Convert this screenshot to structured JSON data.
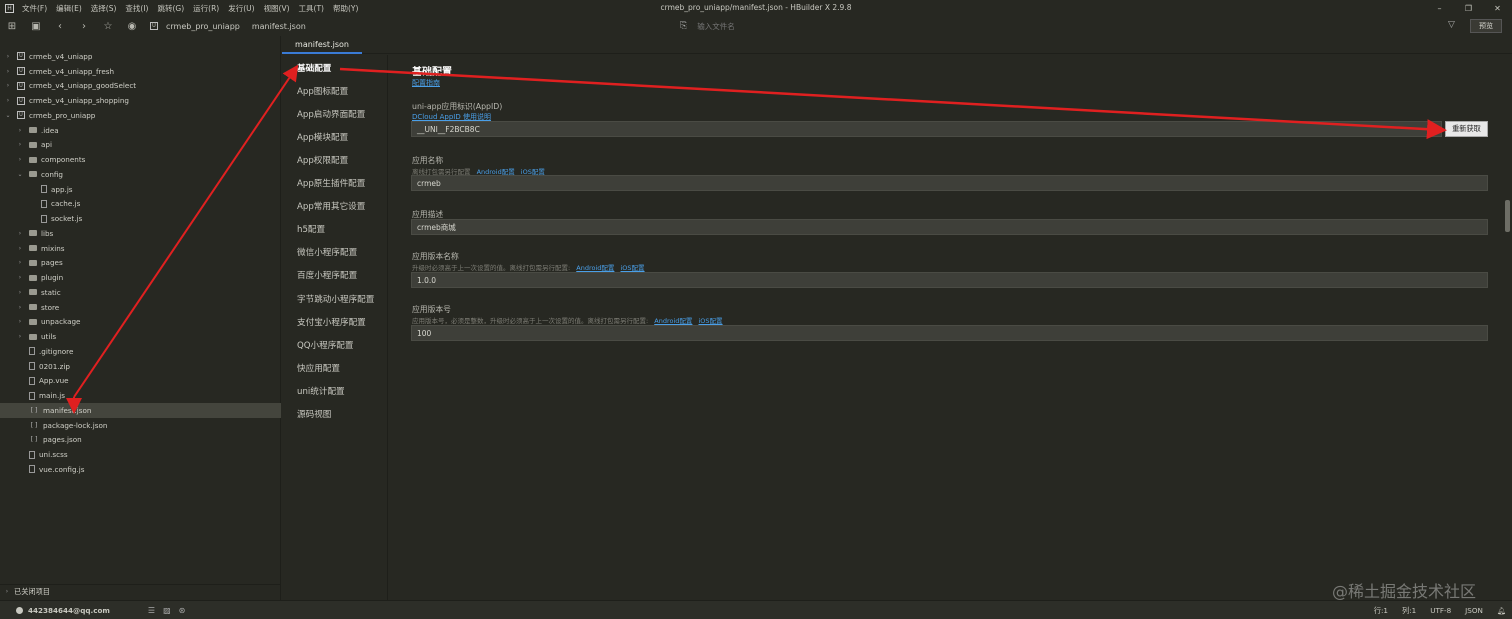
{
  "window": {
    "title": "crmeb_pro_uniapp/manifest.json - HBuilder X 2.9.8"
  },
  "menu": [
    "文件(F)",
    "编辑(E)",
    "选择(S)",
    "查找(I)",
    "跳转(G)",
    "运行(R)",
    "发行(U)",
    "视图(V)",
    "工具(T)",
    "帮助(Y)"
  ],
  "toolbar": {
    "crumb_project": "crmeb_pro_uniapp",
    "crumb_file": "manifest.json",
    "file_search_placeholder": "输入文件名",
    "preview_label": "预览"
  },
  "tree": [
    {
      "label": "crmeb_v4_uniapp",
      "kind": "proj",
      "depth": 0,
      "tw": "›"
    },
    {
      "label": "crmeb_v4_uniapp_fresh",
      "kind": "proj",
      "depth": 0,
      "tw": "›"
    },
    {
      "label": "crmeb_v4_uniapp_goodSelect",
      "kind": "proj",
      "depth": 0,
      "tw": "›"
    },
    {
      "label": "crmeb_v4_uniapp_shopping",
      "kind": "proj",
      "depth": 0,
      "tw": "›"
    },
    {
      "label": "crmeb_pro_uniapp",
      "kind": "proj",
      "depth": 0,
      "tw": "⌄"
    },
    {
      "label": ".idea",
      "kind": "folder",
      "depth": 1,
      "tw": "›"
    },
    {
      "label": "api",
      "kind": "folder",
      "depth": 1,
      "tw": "›"
    },
    {
      "label": "components",
      "kind": "folder",
      "depth": 1,
      "tw": "›"
    },
    {
      "label": "config",
      "kind": "folder",
      "depth": 1,
      "tw": "⌄"
    },
    {
      "label": "app.js",
      "kind": "file",
      "depth": 2,
      "tw": ""
    },
    {
      "label": "cache.js",
      "kind": "file",
      "depth": 2,
      "tw": ""
    },
    {
      "label": "socket.js",
      "kind": "file",
      "depth": 2,
      "tw": ""
    },
    {
      "label": "libs",
      "kind": "folder",
      "depth": 1,
      "tw": "›"
    },
    {
      "label": "mixins",
      "kind": "folder",
      "depth": 1,
      "tw": "›"
    },
    {
      "label": "pages",
      "kind": "folder",
      "depth": 1,
      "tw": "›"
    },
    {
      "label": "plugin",
      "kind": "folder",
      "depth": 1,
      "tw": "›"
    },
    {
      "label": "static",
      "kind": "folder",
      "depth": 1,
      "tw": "›"
    },
    {
      "label": "store",
      "kind": "folder",
      "depth": 1,
      "tw": "›"
    },
    {
      "label": "unpackage",
      "kind": "folder",
      "depth": 1,
      "tw": "›"
    },
    {
      "label": "utils",
      "kind": "folder",
      "depth": 1,
      "tw": "›"
    },
    {
      "label": ".gitignore",
      "kind": "file",
      "depth": 1,
      "tw": ""
    },
    {
      "label": "0201.zip",
      "kind": "file",
      "depth": 1,
      "tw": ""
    },
    {
      "label": "App.vue",
      "kind": "file",
      "depth": 1,
      "tw": ""
    },
    {
      "label": "main.js",
      "kind": "file",
      "depth": 1,
      "tw": ""
    },
    {
      "label": "manifest.json",
      "kind": "json",
      "depth": 1,
      "tw": "",
      "selected": true
    },
    {
      "label": "package-lock.json",
      "kind": "json",
      "depth": 1,
      "tw": ""
    },
    {
      "label": "pages.json",
      "kind": "json",
      "depth": 1,
      "tw": ""
    },
    {
      "label": "uni.scss",
      "kind": "file",
      "depth": 1,
      "tw": ""
    },
    {
      "label": "vue.config.js",
      "kind": "file",
      "depth": 1,
      "tw": ""
    }
  ],
  "closed_projects": "已关闭项目",
  "editor_tab": "manifest.json",
  "config_nav": [
    "基础配置",
    "App图标配置",
    "App启动界面配置",
    "App模块配置",
    "App权限配置",
    "App原生插件配置",
    "App常用其它设置",
    "h5配置",
    "微信小程序配置",
    "百度小程序配置",
    "字节跳动小程序配置",
    "支付宝小程序配置",
    "QQ小程序配置",
    "快应用配置",
    "uni统计配置",
    "源码视图"
  ],
  "form": {
    "section_title": "基础配置",
    "guide_link": "配置指南",
    "appid": {
      "label": "uni-app应用标识(AppID)",
      "help_link": "DCloud AppID 使用说明",
      "value": "__UNI__F2BCB8C",
      "refresh_label": "重新获取"
    },
    "app_name": {
      "label": "应用名称",
      "hint": "离线打包需另行配置",
      "link_android": "Android配置",
      "link_ios": "iOS配置",
      "value": "crmeb"
    },
    "app_desc": {
      "label": "应用描述",
      "value": "crmeb商城"
    },
    "version_name": {
      "label": "应用版本名称",
      "hint": "升级时必须高于上一次设置的值。离线打包需另行配置:",
      "link_android": "Android配置",
      "link_ios": "iOS配置",
      "value": "1.0.0"
    },
    "version_code": {
      "label": "应用版本号",
      "hint": "应用版本号，必须是整数，升级时必须高于上一次设置的值。离线打包需另行配置:",
      "link_android": "Android配置",
      "link_ios": "iOS配置",
      "value": "100"
    }
  },
  "statusbar": {
    "user": "442384644@qq.com",
    "position": "行:1",
    "column": "列:1",
    "encoding": "UTF-8",
    "language": "JSON"
  },
  "watermark": "@稀土掘金技术社区",
  "colors": {
    "background": "#272822",
    "accent_link": "#4a9fe8",
    "annotation_arrow": "#e02020"
  }
}
